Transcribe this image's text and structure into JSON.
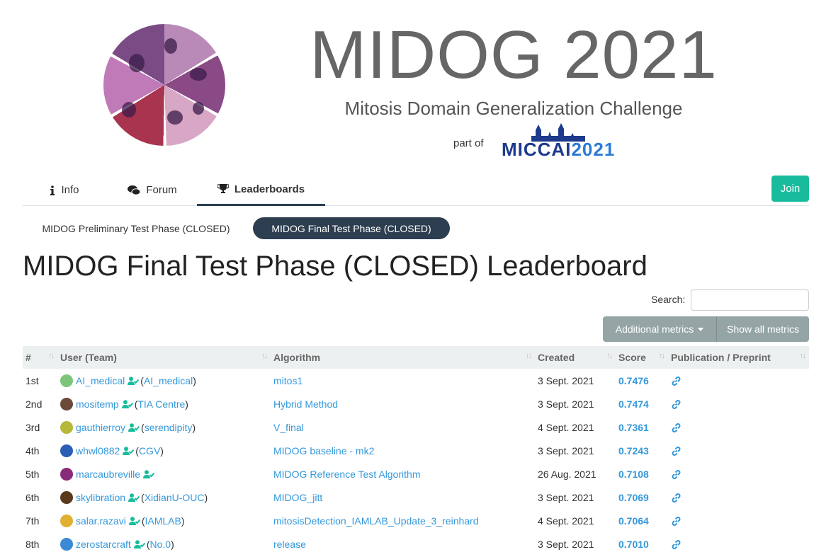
{
  "header": {
    "title": "MIDOG 2021",
    "subtitle": "Mitosis Domain Generalization Challenge",
    "part_of": "part of",
    "miccai_a": "MICCAI",
    "miccai_b": "2021"
  },
  "nav": {
    "tabs": [
      {
        "label": "Info",
        "icon": "info-icon"
      },
      {
        "label": "Forum",
        "icon": "comments-icon"
      },
      {
        "label": "Leaderboards",
        "icon": "trophy-icon",
        "active": true
      }
    ],
    "join_label": "Join"
  },
  "phases": [
    {
      "label": "MIDOG Preliminary Test Phase (CLOSED)",
      "active": false
    },
    {
      "label": "MIDOG Final Test Phase (CLOSED)",
      "active": true
    }
  ],
  "leaderboard": {
    "title": "MIDOG Final Test Phase (CLOSED) Leaderboard",
    "search_label": "Search:",
    "search_value": "",
    "additional_metrics_label": "Additional metrics",
    "show_all_metrics_label": "Show all metrics",
    "columns": [
      "#",
      "User (Team)",
      "Algorithm",
      "Created",
      "Score",
      "Publication / Preprint"
    ],
    "rows": [
      {
        "rank": "1st",
        "user": "AI_medical",
        "team": "AI_medical",
        "algorithm": "mitos1",
        "created": "3 Sept. 2021",
        "score": "0.7476"
      },
      {
        "rank": "2nd",
        "user": "mositemp",
        "team": "TIA Centre",
        "algorithm": "Hybrid Method",
        "created": "3 Sept. 2021",
        "score": "0.7474"
      },
      {
        "rank": "3rd",
        "user": "gauthierroy",
        "team": "serendipity",
        "algorithm": "V_final",
        "created": "4 Sept. 2021",
        "score": "0.7361"
      },
      {
        "rank": "4th",
        "user": "whwl0882",
        "team": "CGV",
        "algorithm": "MIDOG baseline - mk2",
        "created": "3 Sept. 2021",
        "score": "0.7243"
      },
      {
        "rank": "5th",
        "user": "marcaubreville",
        "team": "",
        "algorithm": "MIDOG Reference Test Algorithm",
        "created": "26 Aug. 2021",
        "score": "0.7108"
      },
      {
        "rank": "6th",
        "user": "skylibration",
        "team": "XidianU-OUC",
        "algorithm": "MIDOG_jitt",
        "created": "3 Sept. 2021",
        "score": "0.7069"
      },
      {
        "rank": "7th",
        "user": "salar.razavi",
        "team": "IAMLAB",
        "algorithm": "mitosisDetection_IAMLAB_Update_3_reinhard",
        "created": "4 Sept. 2021",
        "score": "0.7064"
      },
      {
        "rank": "8th",
        "user": "zerostarcraft",
        "team": "No.0",
        "algorithm": "release",
        "created": "3 Sept. 2021",
        "score": "0.7010"
      }
    ]
  },
  "colors": {
    "accent": "#18bc9c",
    "primary": "#2c3e50",
    "link": "#3498db",
    "avatars": [
      "#7dc57a",
      "#6b4a3a",
      "#b5b83a",
      "#2a5fb5",
      "#8a2a7a",
      "#5a3a1a",
      "#e0b030",
      "#3a8ad6"
    ]
  }
}
